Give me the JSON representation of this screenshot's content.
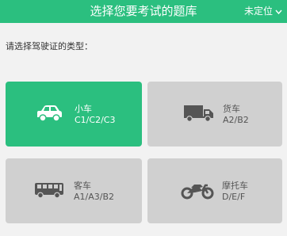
{
  "header": {
    "title": "选择您要考试的题库",
    "location_label": "未定位"
  },
  "prompt": "请选择驾驶证的类型：",
  "colors": {
    "accent": "#2bbf7f",
    "card_normal": "#d0d0d0",
    "icon_normal": "#555555"
  },
  "cards": [
    {
      "name": "小车",
      "types": "C1/C2/C3",
      "icon": "car-icon",
      "selected": true
    },
    {
      "name": "货车",
      "types": "A2/B2",
      "icon": "truck-icon",
      "selected": false
    },
    {
      "name": "客车",
      "types": "A1/A3/B2",
      "icon": "bus-icon",
      "selected": false
    },
    {
      "name": "摩托车",
      "types": "D/E/F",
      "icon": "motorcycle-icon",
      "selected": false
    }
  ]
}
